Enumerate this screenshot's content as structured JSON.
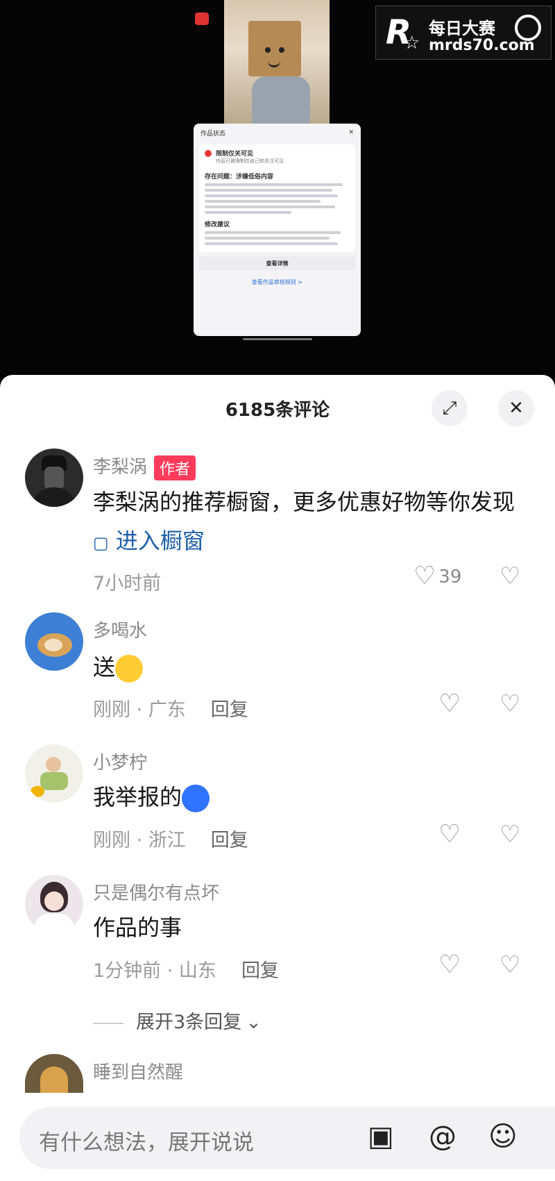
{
  "watermark": {
    "logo": "R",
    "title": "每日大赛",
    "url": "mrds70.com"
  },
  "status_card": {
    "title": "作品状态",
    "warn_title": "限制仅关可见",
    "warn_sub": "作品已被限制仅自己和关注可见",
    "issue_title": "存在问题：涉嫌低俗内容",
    "suggest_title": "修改建议",
    "view_btn": "查看详情",
    "footer_link": "查看作品审核规则 >"
  },
  "header": {
    "title": "6185条评论",
    "expand_icon": "expand-icon",
    "close_icon": "close-icon"
  },
  "comments": [
    {
      "name": "李梨涡",
      "tag": "作者",
      "text": "李梨涡的推荐橱窗，更多优惠好物等你发现",
      "link": "进入橱窗",
      "meta": "7小时前",
      "likes": "39"
    },
    {
      "name": "多喝水",
      "text": "送",
      "meta": "刚刚 · 广东",
      "reply": "回复"
    },
    {
      "name": "小梦柠",
      "text": "我举报的",
      "meta": "刚刚 · 浙江",
      "reply": "回复"
    },
    {
      "name": "只是偶尔有点坏",
      "text": "作品的事",
      "meta": "1分钟前 · 山东",
      "reply": "回复"
    },
    {
      "name": "睡到自然醒"
    }
  ],
  "expand_replies": "展开3条回复",
  "input": {
    "placeholder": "有什么想法，展开说说"
  },
  "colors": {
    "author_tag": "#ff3b5c",
    "link": "#1d5fa8"
  }
}
